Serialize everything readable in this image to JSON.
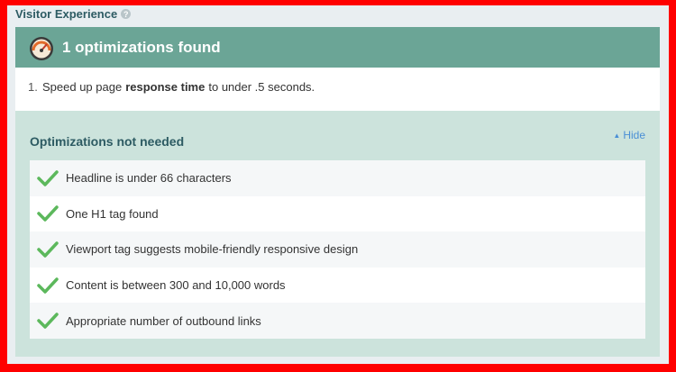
{
  "section": {
    "title": "Visitor Experience",
    "help": "?"
  },
  "card": {
    "header_title": "1 optimizations found",
    "optimizations": [
      {
        "num": "1.",
        "before": "Speed up page",
        "bold": "response time",
        "after": "to under .5 seconds."
      }
    ]
  },
  "not_needed": {
    "title": "Optimizations not needed",
    "hide_label": "Hide",
    "items": [
      "Headline is under 66 characters",
      "One H1 tag found",
      "Viewport tag suggests mobile-friendly responsive design",
      "Content is between 300 and 10,000 words",
      "Appropriate number of outbound links"
    ]
  },
  "colors": {
    "border": "#ff0000",
    "header": "#6ba596",
    "panel": "#cce3dc",
    "check": "#5cb85c",
    "link": "#4a8fd6"
  },
  "icons": [
    "gauge-icon",
    "help-icon",
    "caret-up-icon",
    "check-icon"
  ]
}
